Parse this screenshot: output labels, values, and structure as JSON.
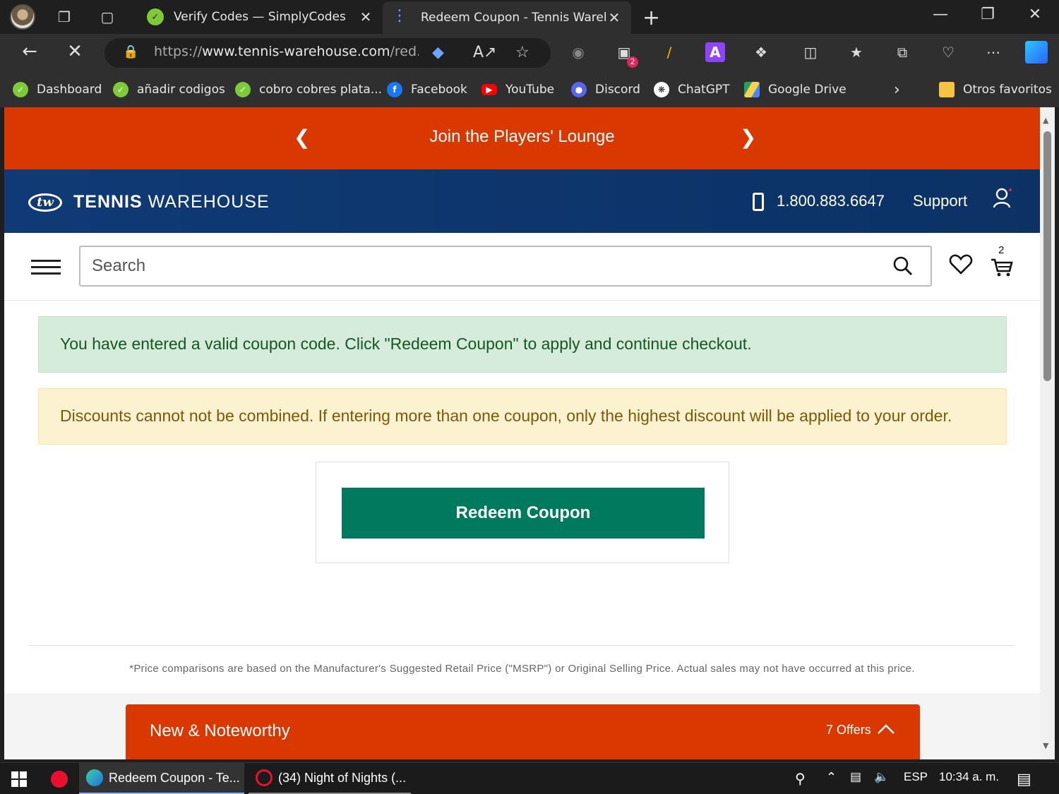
{
  "browser": {
    "tabs": [
      {
        "title": "Verify Codes — SimplyCodes",
        "active": false
      },
      {
        "title": "Redeem Coupon - Tennis Warehouse",
        "active": true
      }
    ],
    "url_prefix": "https://",
    "url_host": "www.tennis-warehouse.com",
    "url_rest": "/red...",
    "extension_badge": "2",
    "bookmarks": [
      {
        "label": "Dashboard",
        "color": "#7ecb3a"
      },
      {
        "label": "añadir codigos",
        "color": "#7ecb3a"
      },
      {
        "label": "cobro cobres plata...",
        "color": "#7ecb3a"
      },
      {
        "label": "Facebook",
        "color": "#1877f2"
      },
      {
        "label": "YouTube",
        "color": "#ff0000"
      },
      {
        "label": "Discord",
        "color": "#5865f2"
      },
      {
        "label": "ChatGPT",
        "color": "#444444"
      },
      {
        "label": "Google Drive",
        "color": "#1fa463"
      }
    ],
    "other_favorites": "Otros favoritos"
  },
  "page": {
    "promo_banner": "Join the Players' Lounge",
    "brand_bold": "TENNIS",
    "brand_light": "WAREHOUSE",
    "brand_mark": "tw",
    "phone": "1.800.883.6647",
    "support": "Support",
    "search_placeholder": "Search",
    "cart_count": "2",
    "success_message": "You have entered a valid coupon code. Click \"Redeem Coupon\" to apply and continue checkout.",
    "warning_message": "Discounts cannot not be combined. If entering more than one coupon, only the highest discount will be applied to your order.",
    "redeem_button": "Redeem Coupon",
    "disclaimer": "*Price comparisons are based on the Manufacturer's Suggested Retail Price (\"MSRP\") or Original Selling Price. Actual sales may not have occurred at this price.",
    "noteworthy_title": "New & Noteworthy",
    "noteworthy_offers": "7 Offers"
  },
  "taskbar": {
    "apps": [
      {
        "label": "Redeem Coupon - Te...",
        "state": "active"
      },
      {
        "label": "(34) Night of Nights (...",
        "state": "open"
      }
    ],
    "language": "ESP",
    "clock": "10:34 a. m."
  },
  "colors": {
    "promo_orange": "#d93900",
    "header_navy": "#0f3a75",
    "redeem_green": "#007a5e",
    "success_bg": "#d6ecdb",
    "warning_bg": "#fdf2cf"
  }
}
